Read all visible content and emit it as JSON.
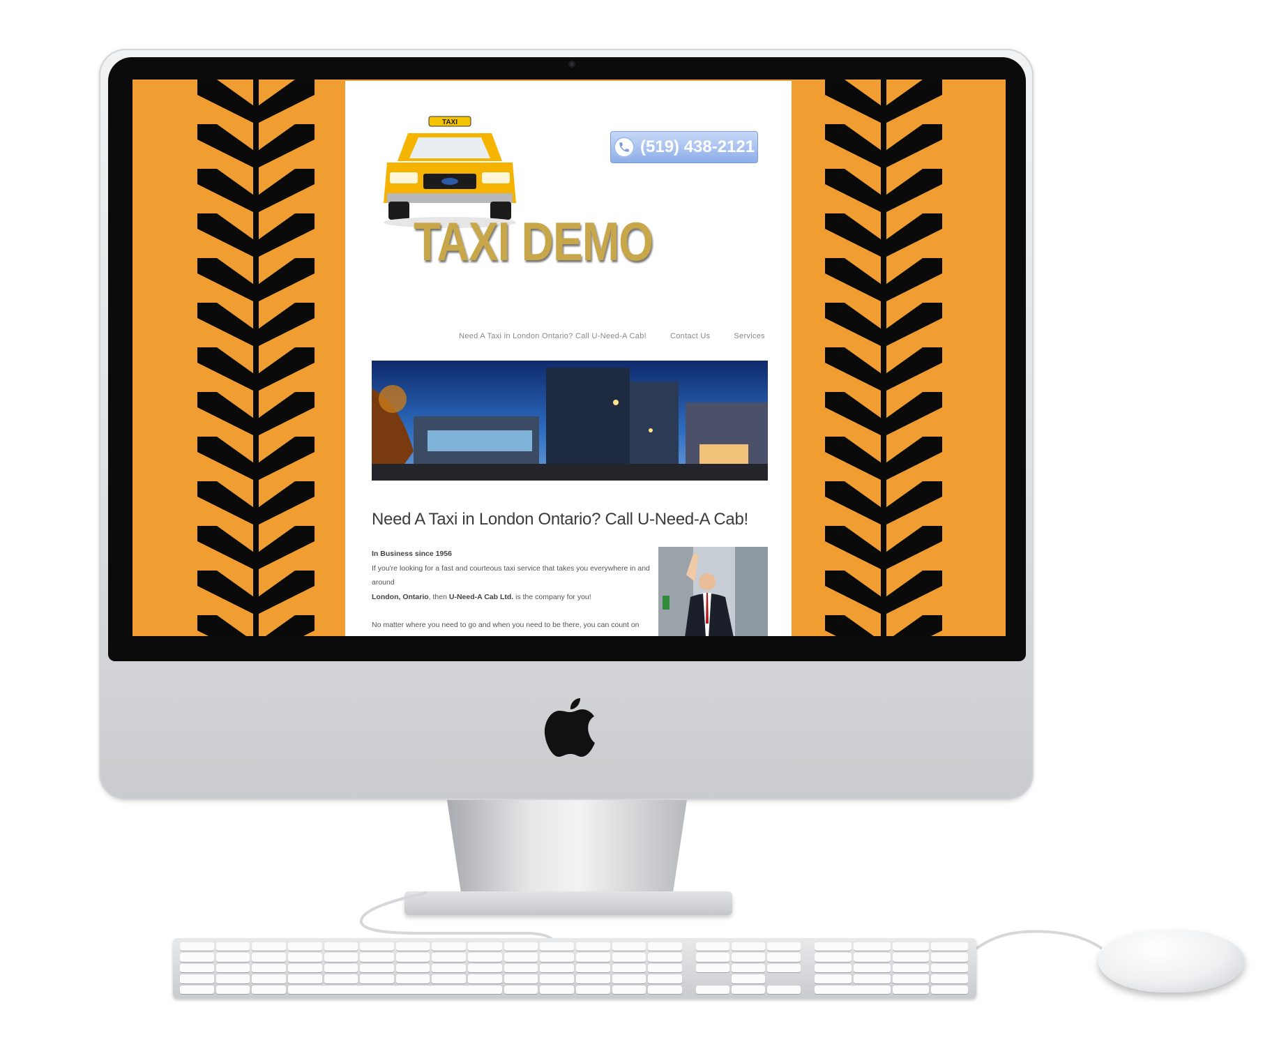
{
  "site": {
    "logo_text": "TAXI DEMO",
    "phone": "(519) 438-2121",
    "nav": [
      "Need A Taxi in London Ontario? Call U-Need-A Cab!",
      "Contact Us",
      "Services"
    ],
    "heading": "Need A Taxi in London Ontario? Call U-Need-A Cab!",
    "subheading": "In Business since 1956",
    "para1_a": "If you're looking for a fast and courteous taxi service that takes you everywhere in and around",
    "para1_b_city": "London, Ontario",
    "para1_b_mid": ", then ",
    "para1_b_company": "U-Need-A Cab Ltd.",
    "para1_b_end": " is the company for you!",
    "para2": "No matter where you need to go and when you need to be there, you can count on our"
  },
  "taxi_sign": "TAXI",
  "colors": {
    "background_orange": "#f09d31",
    "tread_black": "#0a0a0a",
    "logo_gold": "#c8a64a",
    "phone_button": "#8eaee8"
  },
  "icons": [
    "phone-icon",
    "apple-logo-icon"
  ]
}
